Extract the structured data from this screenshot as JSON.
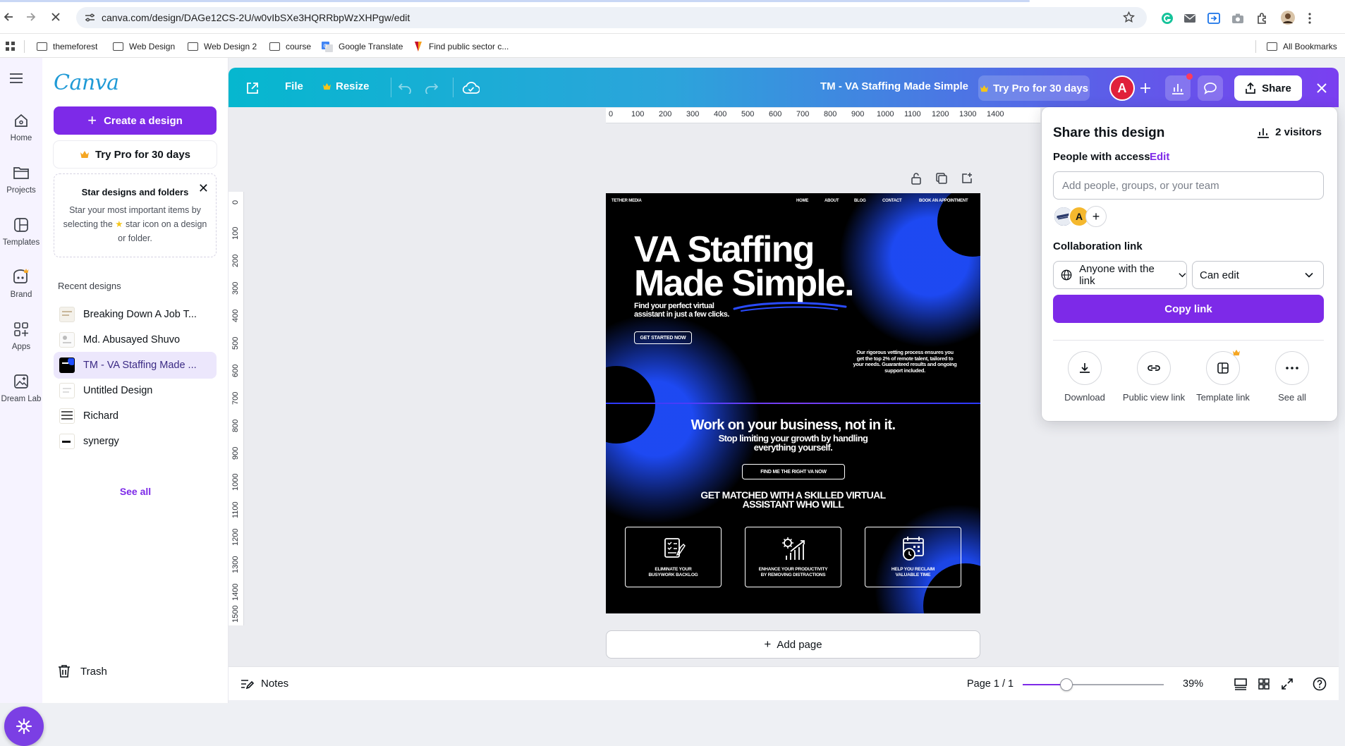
{
  "browser": {
    "url": "canva.com/design/DAGe12CS-2U/w0vIbSXe3HQRRbpWzXHPgw/edit",
    "bookmarks": [
      "themeforest",
      "Web Design",
      "Web Design 2",
      "course",
      "Google Translate",
      "Find public sector c...",
      "All Bookmarks"
    ]
  },
  "rail": {
    "items": [
      {
        "label": "Home",
        "icon": "home-icon"
      },
      {
        "label": "Projects",
        "icon": "folder-icon"
      },
      {
        "label": "Templates",
        "icon": "templates-icon"
      },
      {
        "label": "Brand",
        "icon": "brand-icon"
      },
      {
        "label": "Apps",
        "icon": "apps-icon"
      },
      {
        "label": "Dream Lab",
        "icon": "dream-lab-icon"
      }
    ]
  },
  "side_panel": {
    "create_label": "Create a design",
    "try_pro_label": "Try Pro for 30 days",
    "star_card": {
      "title": "Star designs and folders",
      "desc_1": "Star your most important items by selecting the",
      "desc_2": "star icon on a design or folder."
    },
    "recent_title": "Recent designs",
    "recent": [
      {
        "name": "Breaking Down A Job T..."
      },
      {
        "name": "Md. Abusayed Shuvo"
      },
      {
        "name": "TM - VA Staffing Made ..."
      },
      {
        "name": "Untitled Design"
      },
      {
        "name": "Richard"
      },
      {
        "name": "synergy"
      }
    ],
    "see_all": "See all",
    "trash": "Trash"
  },
  "header": {
    "file": "File",
    "resize": "Resize",
    "design_title": "TM - VA Staffing Made Simple",
    "try_pro": "Try Pro for 30 days",
    "avatar": "A",
    "share": "Share"
  },
  "ruler": {
    "top": [
      "0",
      "100",
      "200",
      "300",
      "400",
      "500",
      "600",
      "700",
      "800",
      "900",
      "1000",
      "1100",
      "1200",
      "1300",
      "1400"
    ],
    "left": [
      "0",
      "100",
      "200",
      "300",
      "400",
      "500",
      "600",
      "700",
      "800",
      "900",
      "1000",
      "1100",
      "1200",
      "1300",
      "1400",
      "1500"
    ]
  },
  "design": {
    "brand": "TETHER MEDIA",
    "nav": [
      "HOME",
      "ABOUT",
      "BLOG",
      "CONTACT",
      "BOOK AN APPOINTMENT"
    ],
    "headline_1": "VA Staffing",
    "headline_2": "Made Simple.",
    "subhead_1": "Find your perfect virtual",
    "subhead_2": "assistant in just a few clicks.",
    "cta_1": "GET STARTED NOW",
    "para": "Our rigorous vetting process ensures you get the top 2% of remote talent, tailored to your needs. Guaranteed results and ongoing support included.",
    "section_title": "Work on your business, not in it.",
    "section_sub_1": "Stop limiting your growth by handling",
    "section_sub_2": "everything yourself.",
    "cta_2": "FIND ME THE RIGHT VA NOW",
    "matched_1": "GET MATCHED WITH A SKILLED VIRTUAL",
    "matched_2": "ASSISTANT WHO WILL",
    "cards": [
      {
        "line1": "ELIMINATE YOUR",
        "line2": "BUSYWORK BACKLOG"
      },
      {
        "line1": "ENHANCE YOUR PRODUCTIVITY",
        "line2": "BY REMOVING DISTRACTIONS"
      },
      {
        "line1": "HELP YOU RECLAIM",
        "line2": "VALUABLE TIME"
      }
    ]
  },
  "add_page": "Add page",
  "footer": {
    "notes": "Notes",
    "page": "Page 1 / 1",
    "zoom": "39%",
    "zoom_level": 0.39
  },
  "share_panel": {
    "title": "Share this design",
    "visitors": "2 visitors",
    "access_label": "People with access",
    "edit": "Edit",
    "input_placeholder": "Add people, groups, or your team",
    "collab_label": "Collaboration link",
    "link_access": "Anyone with the link",
    "permission": "Can edit",
    "copy_link": "Copy link",
    "options": [
      {
        "label": "Download",
        "icon": "download-icon"
      },
      {
        "label": "Public view link",
        "icon": "link-icon"
      },
      {
        "label": "Template link",
        "icon": "template-link-icon"
      },
      {
        "label": "See all",
        "icon": "more-icon"
      }
    ]
  },
  "colors": {
    "accent": "#7d2ae8",
    "header_gradient_start": "#06b7cf",
    "header_gradient_end": "#7a3ff0",
    "avatar": "#e0203a",
    "pro_crown": "#f5a623",
    "design_blue": "#1f4dff"
  }
}
